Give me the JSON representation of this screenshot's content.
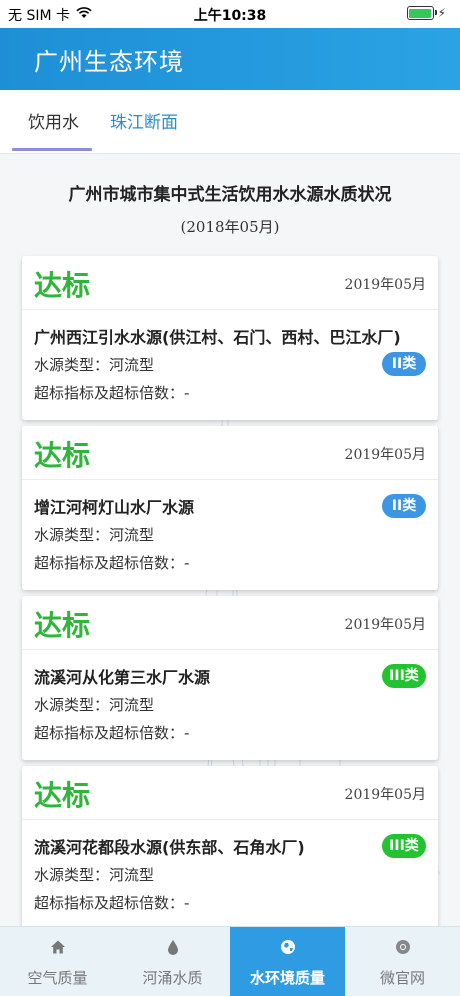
{
  "status_bar": {
    "carrier": "无 SIM 卡",
    "time": "上午10:38"
  },
  "header": {
    "title": "广州生态环境"
  },
  "tabs": [
    {
      "label": "饮用水",
      "active": true
    },
    {
      "label": "珠江断面",
      "active": false
    }
  ],
  "report": {
    "title": "广州市城市集中式生活饮用水水源水质状况",
    "date": "(2018年05月)"
  },
  "cards": [
    {
      "status": "达标",
      "period": "2019年05月",
      "name": "广州西江引水水源(供江村、石门、西村、巴江水厂)",
      "type": "水源类型：河流型",
      "exceed": "超标指标及超标倍数：-",
      "grade": "II类",
      "grade_color": "#3d96e4"
    },
    {
      "status": "达标",
      "period": "2019年05月",
      "name": "增江河柯灯山水厂水源",
      "type": "水源类型：河流型",
      "exceed": "超标指标及超标倍数：-",
      "grade": "II类",
      "grade_color": "#3d96e4"
    },
    {
      "status": "达标",
      "period": "2019年05月",
      "name": "流溪河从化第三水厂水源",
      "type": "水源类型：河流型",
      "exceed": "超标指标及超标倍数：-",
      "grade": "III类",
      "grade_color": "#22c32e"
    },
    {
      "status": "达标",
      "period": "2019年05月",
      "name": "流溪河花都段水源(供东部、石角水厂)",
      "type": "水源类型：河流型",
      "exceed": "超标指标及超标倍数：-",
      "grade": "III类",
      "grade_color": "#22c32e"
    }
  ],
  "bottom_nav": [
    {
      "label": "空气质量",
      "icon": "home-icon",
      "active": false
    },
    {
      "label": "河涌水质",
      "icon": "water-drop-icon",
      "active": false
    },
    {
      "label": "水环境质量",
      "icon": "globe-icon",
      "active": true
    },
    {
      "label": "微官网",
      "icon": "chrome-icon",
      "active": false
    }
  ],
  "colors": {
    "header": "#1e8fd6",
    "status_ok": "#2fb53a",
    "grade_ii": "#3d96e4",
    "grade_iii": "#22c32e",
    "nav_active": "#2f9be2"
  }
}
